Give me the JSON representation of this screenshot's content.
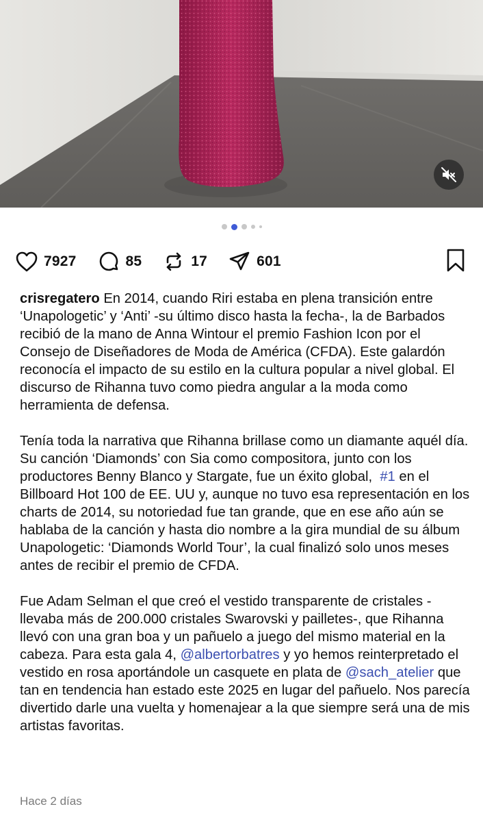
{
  "post": {
    "media": {
      "mute_icon": "speaker-muted-icon",
      "carousel_dots": 5,
      "active_index": 1
    },
    "actions": {
      "likes": "7927",
      "comments": "85",
      "reposts": "17",
      "shares": "601"
    },
    "caption": {
      "username": "crisregatero",
      "p1": "En 2014, cuando Riri estaba en plena transición entre ‘Unapologetic’ y ‘Anti’ -su último disco hasta la fecha-, la de Barbados recibió de la mano de Anna Wintour el premio Fashion Icon por el Consejo de Diseñadores de Moda de América (CFDA). Este galardón reconocía el impacto de su estilo en la cultura popular a nivel global. El discurso de Rihanna tuvo como piedra angular a la moda como herramienta de defensa.",
      "p2_before": "Tenía toda la narrativa que Rihanna brillase como un diamante aquél día. Su canción ‘Diamonds’ con Sia como compositora, junto con los productores Benny Blanco y Stargate, fue un éxito global,  ",
      "p2_hashtag": "#1",
      "p2_after": " en el Billboard Hot 100 de EE. UU y, aunque no tuvo esa representación en los charts de 2014, su notoriedad fue tan grande, que en ese año aún se hablaba de la canción y hasta dio nombre a la gira mundial de su álbum Unapologetic: ‘Diamonds World Tour’, la cual finalizó solo unos meses antes de recibir el premio de CFDA.",
      "p3_before": "Fue Adam Selman el que creó el vestido transparente de cristales -llevaba más de 200.000 cristales Swarovski y pailletes-, que Rihanna llevó con una gran boa y un pañuelo a juego del mismo material en la cabeza. Para esta gala 4, ",
      "p3_mention1": "@albertorbatres",
      "p3_mid": " y yo hemos reinterpretado el vestido en rosa aportándole un casquete en plata de ",
      "p3_mention2": "@sach_atelier",
      "p3_after": " que tan en tendencia han estado este 2025 en lugar del pañuelo. Nos parecía divertido darle una vuelta y homenajear a la que siempre será una de mis artistas favoritas."
    },
    "timestamp": "Hace 2 días",
    "colors": {
      "link": "#3b4fb0",
      "active_dot": "#3f5bd6",
      "dress": "#b0255c"
    }
  }
}
